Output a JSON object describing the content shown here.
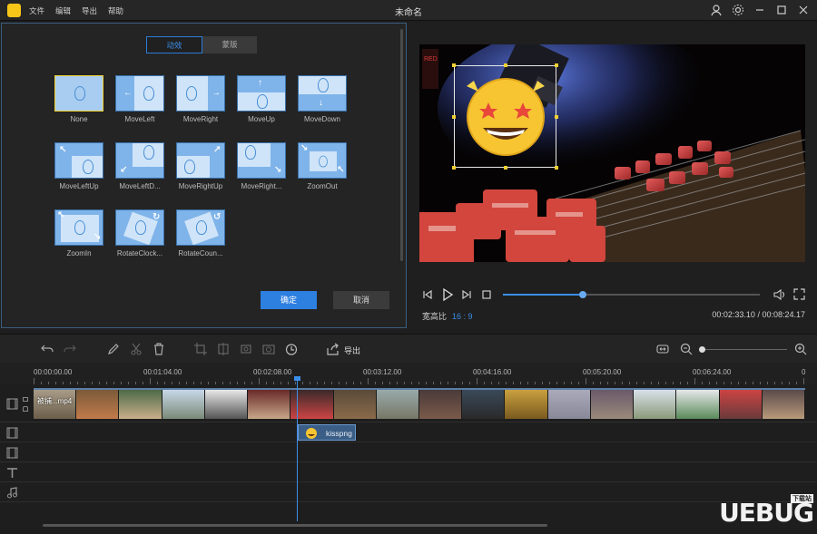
{
  "window": {
    "title": "未命名",
    "menu": [
      "文件",
      "编辑",
      "导出",
      "帮助"
    ]
  },
  "effects_panel": {
    "tabs": [
      {
        "label": "动效",
        "active": true
      },
      {
        "label": "蒙版",
        "active": false
      }
    ],
    "effects": [
      {
        "label": "None",
        "selected": true,
        "icon": "balloon-still-icon"
      },
      {
        "label": "MoveLeft",
        "icon": "move-left-icon"
      },
      {
        "label": "MoveRight",
        "icon": "move-right-icon"
      },
      {
        "label": "MoveUp",
        "icon": "move-up-icon"
      },
      {
        "label": "MoveDown",
        "icon": "move-down-icon"
      },
      {
        "label": "MoveLeftUp",
        "icon": "move-left-up-icon"
      },
      {
        "label": "MoveLeftD...",
        "icon": "move-left-down-icon"
      },
      {
        "label": "MoveRightUp",
        "icon": "move-right-up-icon"
      },
      {
        "label": "MoveRight...",
        "icon": "move-right-down-icon"
      },
      {
        "label": "ZoomOut",
        "icon": "zoom-out-icon"
      },
      {
        "label": "ZoomIn",
        "icon": "zoom-in-icon"
      },
      {
        "label": "RotateClock...",
        "icon": "rotate-clockwise-icon"
      },
      {
        "label": "RotateCoun...",
        "icon": "rotate-counter-icon"
      }
    ],
    "confirm_label": "确定",
    "cancel_label": "取消"
  },
  "preview": {
    "aspect_label": "宽高比",
    "aspect_value": "16 : 9",
    "time_current": "00:02:33.10",
    "time_total": "00:08:24.17",
    "progress": 0.31
  },
  "toolbar": {
    "export_label": "导出",
    "zoom_level": 0.0
  },
  "timeline": {
    "ruler": [
      "00:00:00.00",
      "00:01:04.00",
      "00:02:08.00",
      "00:03:12.00",
      "00:04:16.00",
      "00:05:20.00",
      "00:06:24.00",
      "0"
    ],
    "video_clip_name": "被捕...mp4",
    "sticker_clip_name": "kisspng"
  },
  "watermark": {
    "text": "UEBUG",
    "badge": "下载站"
  },
  "colors": {
    "accent": "#2d7fe0",
    "selection": "#f0d030",
    "panel_border": "#3b5f7e"
  }
}
